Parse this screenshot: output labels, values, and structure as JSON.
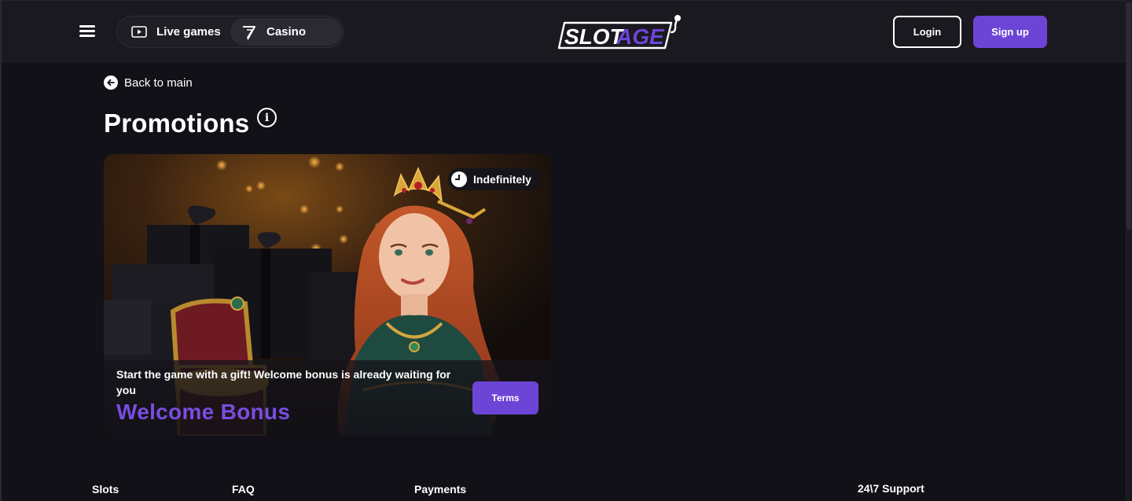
{
  "header": {
    "nav": {
      "live_games": "Live games",
      "casino": "Casino"
    },
    "logo": {
      "text_slot": "SLOT",
      "text_age": "AGE"
    },
    "login_label": "Login",
    "signup_label": "Sign up"
  },
  "back_link": {
    "label": "Back to main",
    "icon": "arrow-left-icon"
  },
  "page": {
    "title": "Promotions",
    "info_icon": "info-icon"
  },
  "promo": {
    "duration": "Indefinitely",
    "description": "Start the game with a gift! Welcome bonus is already waiting for you",
    "name": "Welcome Bonus",
    "terms_label": "Terms"
  },
  "footer": {
    "slots": "Slots",
    "faq": "FAQ",
    "payments": "Payments",
    "support": "24\\7 Support"
  },
  "colors": {
    "background": "#121117",
    "header": "#1a1920",
    "accent": "#6c45d6",
    "promo_title": "#7a4de0"
  }
}
